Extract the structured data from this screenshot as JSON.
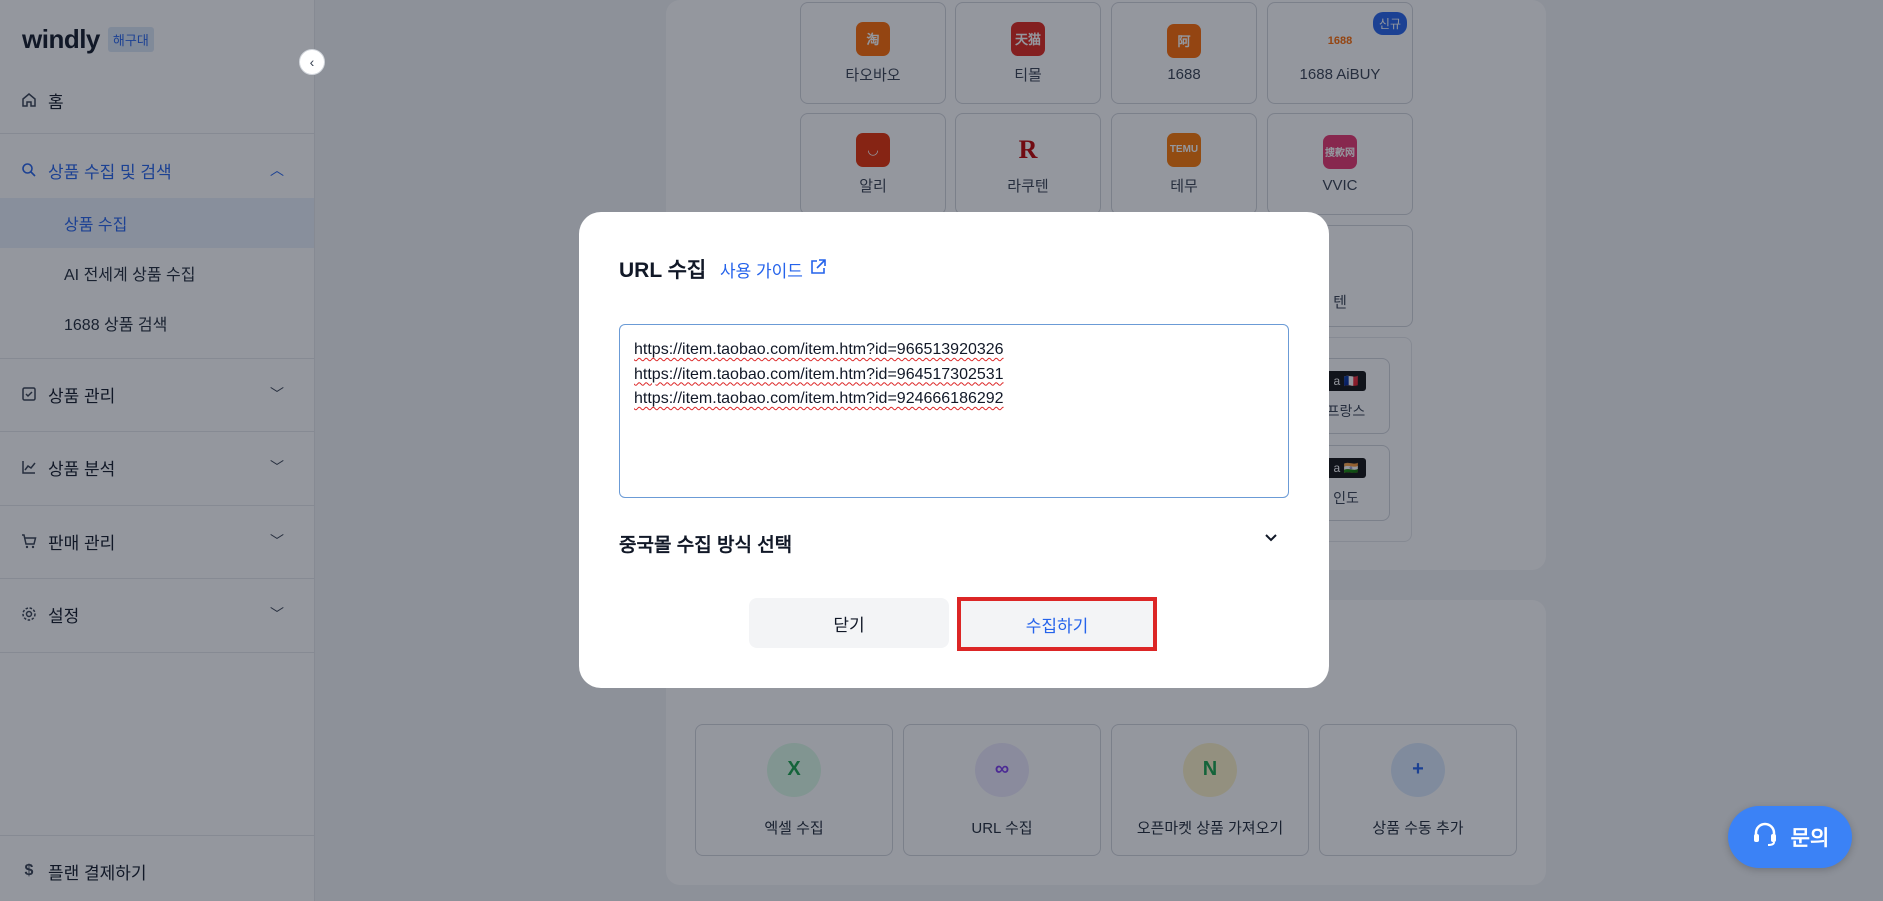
{
  "brand": {
    "name": "windly",
    "tag": "해구대"
  },
  "sidebar": {
    "home": "홈",
    "group_collect": "상품 수집 및 검색",
    "sub_items": [
      "상품 수집",
      "AI 전세계 상품 수집",
      "1688 상품 검색"
    ],
    "manage": "상품 관리",
    "analysis": "상품 분석",
    "sales": "판매 관리",
    "settings": "설정",
    "plan": "플랜 결제하기"
  },
  "malls": {
    "taobao": "타오바오",
    "tmall": "티몰",
    "m1688": "1688",
    "aibuy": "1688 AiBUY",
    "aibuy_badge": "신규",
    "ali": "알리",
    "rakuten": "라쿠텐",
    "temu": "테무",
    "vvic": "VVIC",
    "partial": "텐",
    "france": "프랑스",
    "india": "인도"
  },
  "collect_options": {
    "excel": "엑셀 수집",
    "url": "URL 수집",
    "openmarket": "오픈마켓 상품 가져오기",
    "manual": "상품 수동 추가"
  },
  "modal": {
    "title": "URL 수집",
    "guide": "사용 가이드",
    "urls": [
      "https://item.taobao.com/item.htm?id=966513920326",
      "https://item.taobao.com/item.htm?id=964517302531",
      "https://item.taobao.com/item.htm?id=924666186292"
    ],
    "method_label": "중국몰 수집 방식 선택",
    "close": "닫기",
    "collect": "수집하기"
  },
  "chat": {
    "label": "문의"
  },
  "colors": {
    "accent": "#2563eb",
    "highlight": "#dc2626",
    "chat": "#3b82f6"
  }
}
